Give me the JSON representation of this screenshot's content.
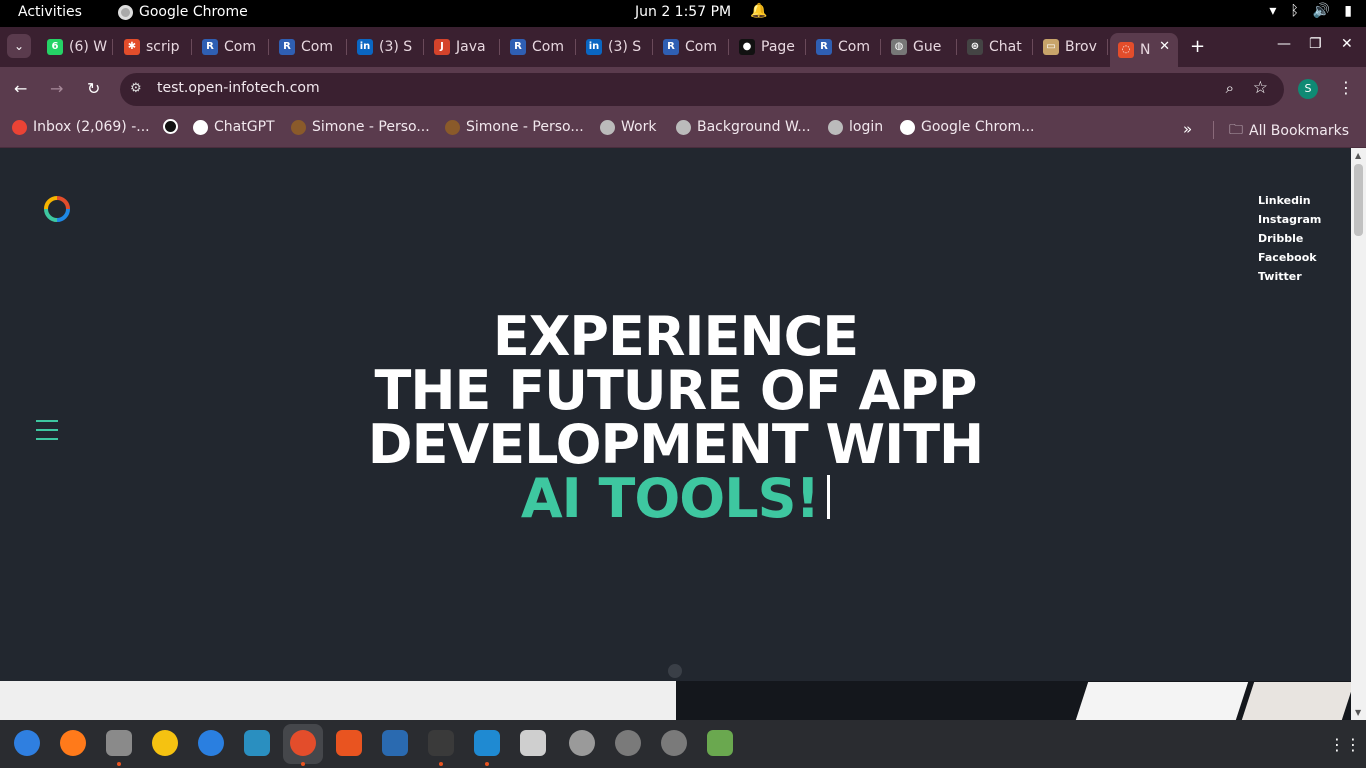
{
  "topbar": {
    "activities": "Activities",
    "app_name": "Google Chrome",
    "clock": "Jun 2  1:57 PM"
  },
  "tabs": [
    {
      "label": "(6) W",
      "icon": "whatsapp-icon",
      "color": "#25d366",
      "glyph": "6"
    },
    {
      "label": "scrip",
      "icon": "pinwheel-icon",
      "color": "#e34d2b",
      "glyph": "✱"
    },
    {
      "label": "Com",
      "icon": "replit-icon",
      "color": "#2f5fb3",
      "glyph": "R"
    },
    {
      "label": "Com",
      "icon": "replit-icon",
      "color": "#2f5fb3",
      "glyph": "R"
    },
    {
      "label": "(3) S",
      "icon": "linkedin-icon",
      "color": "#0a66c2",
      "glyph": "in"
    },
    {
      "label": "Java",
      "icon": "java-icon",
      "color": "#d5432b",
      "glyph": "J"
    },
    {
      "label": "Com",
      "icon": "replit-icon",
      "color": "#2f5fb3",
      "glyph": "R"
    },
    {
      "label": "(3) S",
      "icon": "linkedin-icon",
      "color": "#0a66c2",
      "glyph": "in"
    },
    {
      "label": "Com",
      "icon": "replit-icon",
      "color": "#2f5fb3",
      "glyph": "R"
    },
    {
      "label": "Page",
      "icon": "github-icon",
      "color": "#111111",
      "glyph": "●"
    },
    {
      "label": "Com",
      "icon": "replit-icon",
      "color": "#2f5fb3",
      "glyph": "R"
    },
    {
      "label": "Gue",
      "icon": "globe-icon",
      "color": "#777777",
      "glyph": "◍"
    },
    {
      "label": "Chat",
      "icon": "chatgpt-icon",
      "color": "#444444",
      "glyph": "⊛"
    },
    {
      "label": "Brov",
      "icon": "browser-icon",
      "color": "#c8a46a",
      "glyph": "▭"
    },
    {
      "label": "N",
      "icon": "site-logo-icon",
      "color": "#e34d2b",
      "glyph": "◌"
    }
  ],
  "toolbar": {
    "url": "test.open-infotech.com",
    "profile_initial": "S"
  },
  "bookmarks": [
    {
      "label": "Inbox (2,069) -...",
      "icon": "gmail-icon"
    },
    {
      "label": "",
      "icon": "circle-logo-icon"
    },
    {
      "label": "ChatGPT",
      "icon": "chatgpt-icon"
    },
    {
      "label": "Simone - Perso...",
      "icon": "bookmark-page-icon"
    },
    {
      "label": "Simone - Perso...",
      "icon": "bookmark-page-icon"
    },
    {
      "label": "Work",
      "icon": "globe-icon"
    },
    {
      "label": "Background W...",
      "icon": "globe-icon"
    },
    {
      "label": "login",
      "icon": "globe-icon"
    },
    {
      "label": "Google Chrom...",
      "icon": "google-icon"
    }
  ],
  "bookmarks_all": "All Bookmarks",
  "page": {
    "social": [
      "Linkedin",
      "Instagram",
      "Dribble",
      "Facebook",
      "Twitter"
    ],
    "hero_line1": "EXPERIENCE",
    "hero_line2": "THE FUTURE OF APP",
    "hero_line3": "DEVELOPMENT WITH",
    "hero_accent": "AI TOOLS!",
    "accent_color": "#3ec7a0",
    "background_color": "#22272f"
  },
  "dock": [
    {
      "name": "thunderbird-icon",
      "color": "#2f7fe0",
      "running": false
    },
    {
      "name": "firefox-icon",
      "color": "#ff7a1a",
      "running": false
    },
    {
      "name": "files-icon",
      "color": "#8a8a8a",
      "running": true
    },
    {
      "name": "rhythmbox-icon",
      "color": "#f5c211",
      "running": false
    },
    {
      "name": "help-icon",
      "color": "#2a7fe0",
      "running": false
    },
    {
      "name": "image-viewer-icon",
      "color": "#2a8fc0",
      "running": false
    },
    {
      "name": "chrome-icon",
      "color": "#e34d2b",
      "running": true
    },
    {
      "name": "app-center-icon",
      "color": "#e95420",
      "running": false
    },
    {
      "name": "writer-icon",
      "color": "#2a6ab0",
      "running": false
    },
    {
      "name": "terminal-icon",
      "color": "#3a3a3a",
      "running": true
    },
    {
      "name": "vscode-icon",
      "color": "#1f8ad2",
      "running": true
    },
    {
      "name": "screenshot-icon",
      "color": "#cfcfcf",
      "running": false
    },
    {
      "name": "settings-icon",
      "color": "#9a9a9a",
      "running": false
    },
    {
      "name": "disk-icon",
      "color": "#7a7a7a",
      "running": false
    },
    {
      "name": "disk-icon-2",
      "color": "#7a7a7a",
      "running": false
    },
    {
      "name": "trash-icon",
      "color": "#6aa84f",
      "running": false
    }
  ]
}
